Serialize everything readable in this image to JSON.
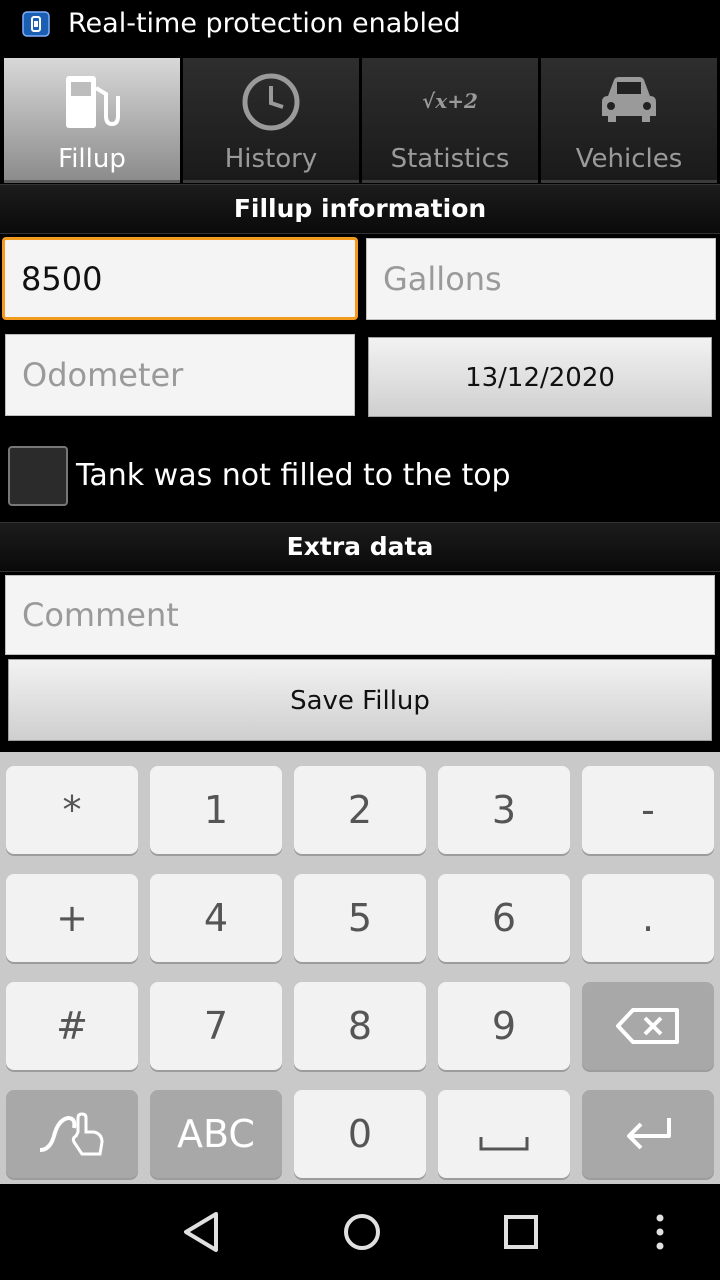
{
  "status_bar": {
    "notification_text": "Real-time protection enabled"
  },
  "tabs": [
    {
      "label": "Fillup",
      "icon": "fuel-pump-icon",
      "selected": true
    },
    {
      "label": "History",
      "icon": "clock-icon",
      "selected": false
    },
    {
      "label": "Statistics",
      "icon": "square-root-icon",
      "icon_text": "√x+2",
      "selected": false
    },
    {
      "label": "Vehicles",
      "icon": "car-icon",
      "selected": false
    }
  ],
  "fillup": {
    "header": "Fillup information",
    "price_value": "8500",
    "gallons_placeholder": "Gallons",
    "odometer_placeholder": "Odometer",
    "date_label": "13/12/2020",
    "tank_checkbox_label": "Tank was not filled to the top",
    "tank_checked": false
  },
  "extra": {
    "header": "Extra data",
    "comment_placeholder": "Comment",
    "save_label": "Save Fillup"
  },
  "keyboard": {
    "rows": [
      [
        "*",
        "1",
        "2",
        "3",
        "-"
      ],
      [
        "+",
        "4",
        "5",
        "6",
        "."
      ],
      [
        "#",
        "7",
        "8",
        "9",
        "backspace-icon"
      ],
      [
        "gesture-icon",
        "ABC",
        "0",
        "space-icon",
        "enter-icon"
      ]
    ],
    "abc_label": "ABC"
  },
  "nav_bar": {
    "buttons": [
      "back-icon",
      "home-icon",
      "recents-icon",
      "more-icon"
    ]
  },
  "colors": {
    "focus_border": "#f39b1f",
    "background": "#000000",
    "keyboard_bg": "#c9c9c9"
  }
}
